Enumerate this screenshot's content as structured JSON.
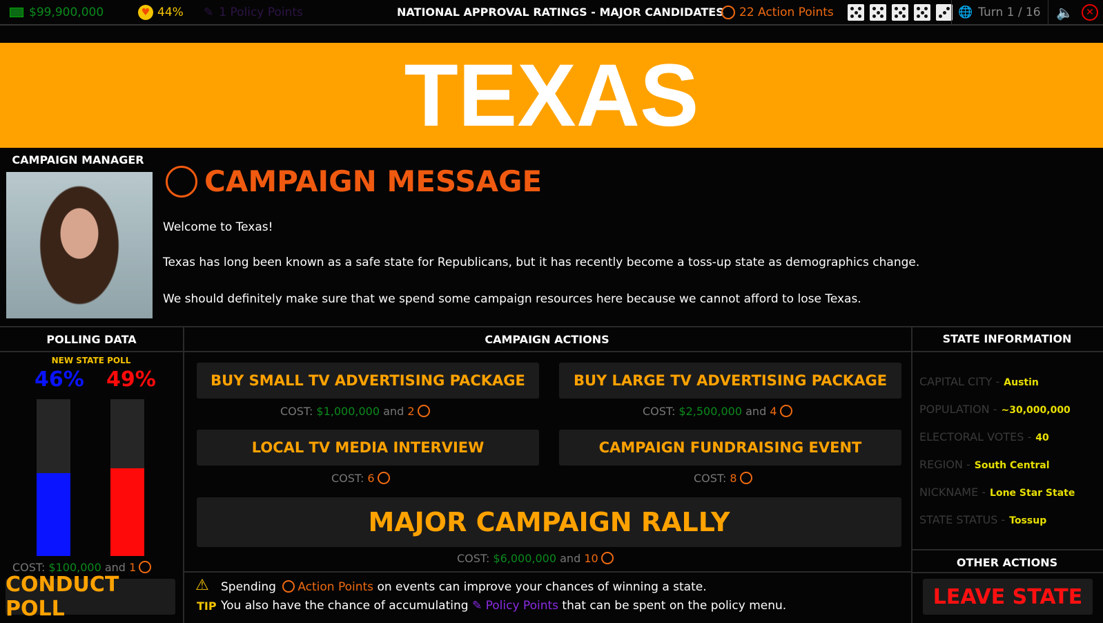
{
  "topbar": {
    "money": "$99,900,000",
    "approval": "44%",
    "policy_points": "1 Policy Points",
    "title": "NATIONAL APPROVAL RATINGS - MAJOR CANDIDATES",
    "action_points": "22 Action Points",
    "dice": [
      5,
      5,
      5,
      5,
      3
    ],
    "turn": "Turn 1 / 16"
  },
  "state": {
    "name": "TEXAS"
  },
  "manager": {
    "label": "CAMPAIGN MANAGER"
  },
  "message": {
    "title": "CAMPAIGN MESSAGE",
    "lines": [
      "Welcome to Texas!",
      "Texas has long been known as a safe state for Republicans, but it has recently become a toss-up state as demographics change.",
      "We should definitely make sure that we spend some campaign resources here because we cannot afford to lose Texas."
    ]
  },
  "polling": {
    "header": "POLLING DATA",
    "subtitle": "NEW STATE POLL",
    "blue": "46%",
    "red": "49%",
    "blue_value": 46,
    "red_value": 49,
    "colors": {
      "blue": "#0a14ff",
      "red": "#ff0a0a"
    },
    "cost_label": "COST:",
    "cost_money": "$100,000",
    "and": "and",
    "cost_ap": "1",
    "button": "CONDUCT POLL"
  },
  "actions": {
    "header": "CAMPAIGN ACTIONS",
    "items": [
      {
        "label": "BUY SMALL TV ADVERTISING PACKAGE",
        "cost_label": "COST:",
        "money": "$1,000,000",
        "and": "and",
        "ap": "2"
      },
      {
        "label": "BUY LARGE TV ADVERTISING PACKAGE",
        "cost_label": "COST:",
        "money": "$2,500,000",
        "and": "and",
        "ap": "4"
      },
      {
        "label": "LOCAL TV MEDIA INTERVIEW",
        "cost_label": "COST:",
        "ap": "6"
      },
      {
        "label": "CAMPAIGN FUNDRAISING EVENT",
        "cost_label": "COST:",
        "ap": "8"
      },
      {
        "label": "MAJOR CAMPAIGN RALLY",
        "cost_label": "COST:",
        "money": "$6,000,000",
        "and": "and",
        "ap": "10"
      }
    ]
  },
  "tip": {
    "label": "TIP",
    "l1a": "Spending",
    "l1b": "Action Points",
    "l1c": "on events can improve your chances of winning a state.",
    "l2a": "You also have the chance of accumulating",
    "l2b": "Policy Points",
    "l2c": "that can be spent on the policy menu."
  },
  "info": {
    "header": "STATE INFORMATION",
    "rows": [
      {
        "k": "CAPITAL CITY -",
        "v": "Austin"
      },
      {
        "k": "POPULATION -",
        "v": "~30,000,000"
      },
      {
        "k": "ELECTORAL VOTES -",
        "v": "40"
      },
      {
        "k": "REGION -",
        "v": "South Central"
      },
      {
        "k": "NICKNAME -",
        "v": "Lone Star State"
      },
      {
        "k": "STATE STATUS -",
        "v": "Tossup"
      }
    ]
  },
  "other": {
    "header": "OTHER ACTIONS",
    "leave": "LEAVE STATE"
  }
}
